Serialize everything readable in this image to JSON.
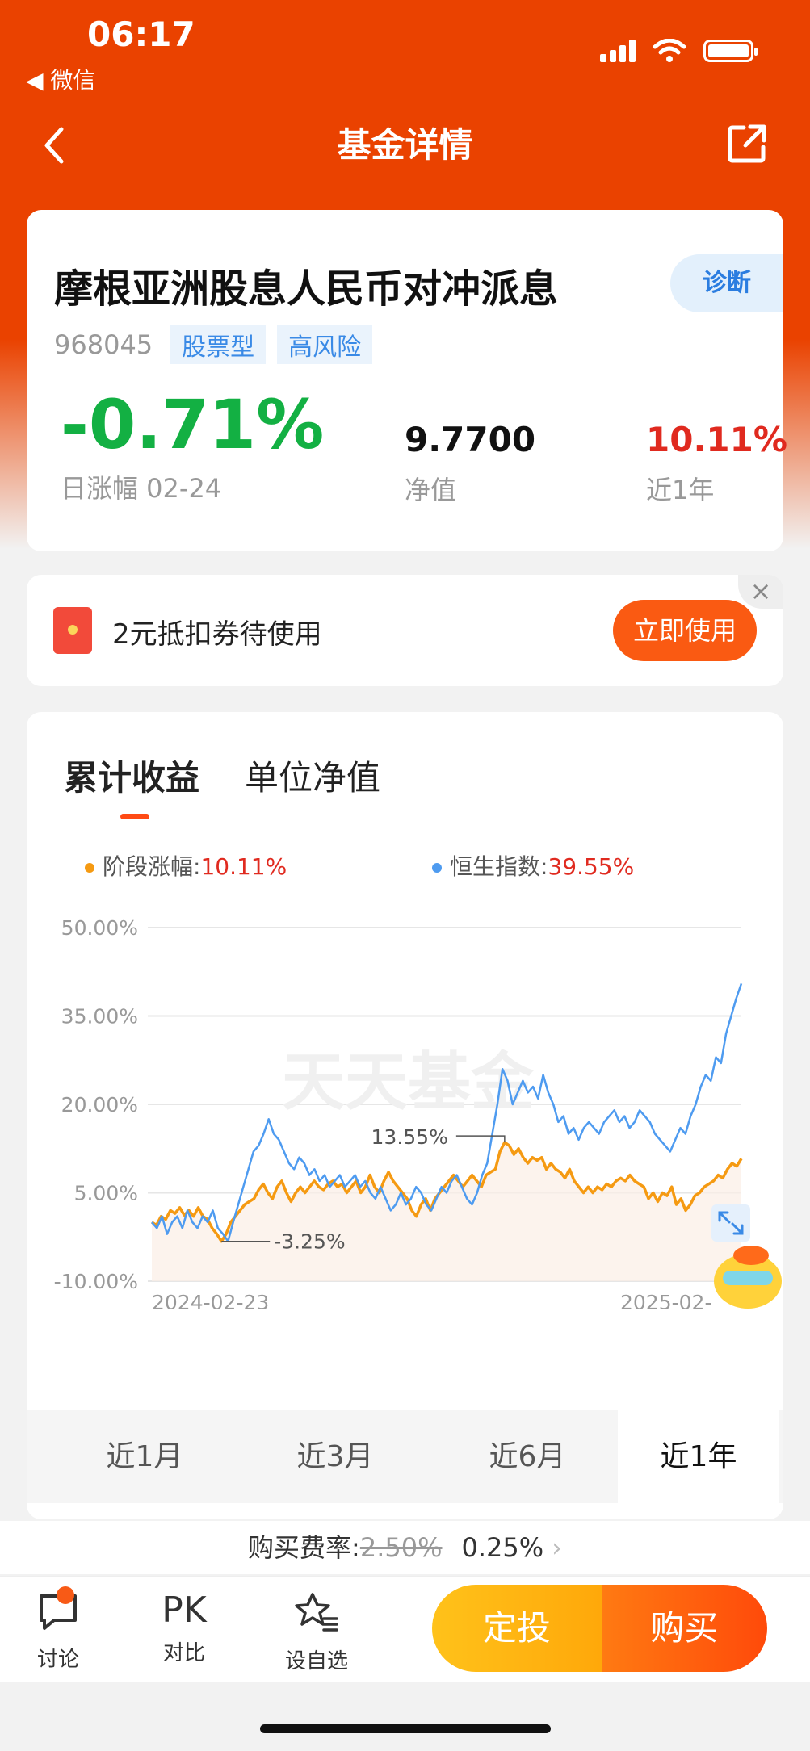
{
  "status_bar": {
    "time": "06:17",
    "back_app": "◀ 微信"
  },
  "nav": {
    "title": "基金详情"
  },
  "fund": {
    "name": "摩根亚洲股息人民币对冲派息",
    "diagnose_label": "诊断",
    "code": "968045",
    "tags": [
      "股票型",
      "高风险"
    ],
    "daily_change": "-0.71%",
    "daily_change_label": "日涨幅 02-24",
    "nav_value": "9.7700",
    "nav_label": "净值",
    "year_return": "10.11%",
    "year_label": "近1年"
  },
  "coupon": {
    "text": "2元抵扣券待使用",
    "button": "立即使用",
    "close": "×"
  },
  "chart_section": {
    "tabs": [
      "累计收益",
      "单位净值"
    ],
    "legend": [
      {
        "label": "阶段涨幅:",
        "value": "10.11%",
        "color": "#f59a12"
      },
      {
        "label": "恒生指数:",
        "value": "39.55%",
        "color": "#4e9bf0"
      }
    ],
    "watermark": "天天基金",
    "periods": [
      "近1月",
      "近3月",
      "近6月",
      "近1年"
    ],
    "active_period": 3
  },
  "chart_data": {
    "type": "line",
    "ylim": [
      -10,
      50
    ],
    "yticks": [
      "50.00%",
      "35.00%",
      "20.00%",
      "5.00%",
      "-10.00%"
    ],
    "ytick_values": [
      50,
      35,
      20,
      5,
      -10
    ],
    "x_labels": [
      "2024-02-23",
      "2025-02-"
    ],
    "annotations": [
      {
        "text": "13.55%",
        "value": 13.55
      },
      {
        "text": "-3.25%",
        "value": -3.25
      }
    ],
    "series": [
      {
        "name": "阶段涨幅",
        "color": "#f59a12",
        "values": [
          0,
          -0.5,
          1,
          0.5,
          2,
          1.5,
          2.5,
          1.2,
          2,
          1,
          2.5,
          1,
          0.5,
          -1,
          -2,
          -3.25,
          -2,
          0,
          1,
          2,
          3,
          3.5,
          4,
          5.5,
          6.5,
          5,
          4,
          6,
          7,
          5,
          3.5,
          5,
          6,
          5,
          6,
          7,
          6,
          5.5,
          6.5,
          7,
          6,
          6.5,
          5,
          6,
          7,
          5,
          6,
          8,
          6,
          5,
          7,
          8.5,
          7,
          6,
          5,
          4,
          2,
          1,
          3,
          4,
          2,
          4,
          5,
          6,
          7,
          8,
          7,
          6,
          7,
          8,
          7,
          6,
          8,
          8.5,
          9,
          12,
          13.55,
          13,
          11.5,
          12.5,
          11,
          10,
          11,
          10.5,
          11,
          9,
          10,
          9,
          8.5,
          7.5,
          9,
          7,
          6,
          5,
          6,
          5,
          6,
          5.5,
          6.5,
          6,
          7,
          7.5,
          7,
          8,
          7,
          6.5,
          6,
          4,
          5,
          3.5,
          5,
          4.5,
          6,
          3,
          4,
          2,
          3,
          4.5,
          5,
          6,
          6.5,
          7,
          8,
          7.5,
          9,
          10,
          9.5,
          10.8
        ]
      },
      {
        "name": "恒生指数",
        "color": "#4e9bf0",
        "values": [
          0,
          -1,
          1,
          -2,
          0,
          1,
          -1,
          2,
          0,
          -1,
          1,
          0,
          2,
          -1,
          -2,
          -3.25,
          0,
          3,
          6,
          9,
          12,
          13,
          15,
          17.5,
          15,
          14,
          12,
          10,
          9,
          11,
          10,
          8,
          9,
          7,
          8,
          6,
          7,
          8,
          6,
          7,
          8,
          6,
          7,
          5,
          4,
          6,
          4,
          2,
          3,
          5,
          3,
          4,
          6,
          5,
          3,
          2,
          4,
          6,
          5,
          7,
          8,
          6,
          4,
          3,
          5,
          8,
          10,
          15,
          20,
          26,
          24,
          20,
          22,
          24,
          22,
          23,
          21,
          25,
          22,
          20,
          17,
          18,
          15,
          16,
          14,
          16,
          17,
          16,
          15,
          17,
          18,
          19,
          17,
          18,
          16,
          17,
          19,
          18,
          17,
          15,
          14,
          13,
          12,
          14,
          16,
          15,
          18,
          20,
          23,
          25,
          24,
          28,
          27,
          32,
          35,
          38,
          40.5
        ]
      }
    ]
  },
  "fee": {
    "label": "购买费率:",
    "old": "2.50%",
    "new": "0.25%",
    "arrow": "›"
  },
  "bottom_bar": {
    "discuss": "讨论",
    "pk_icon": "PK",
    "compare": "对比",
    "watchlist": "设自选",
    "invest": "定投",
    "buy": "购买"
  }
}
